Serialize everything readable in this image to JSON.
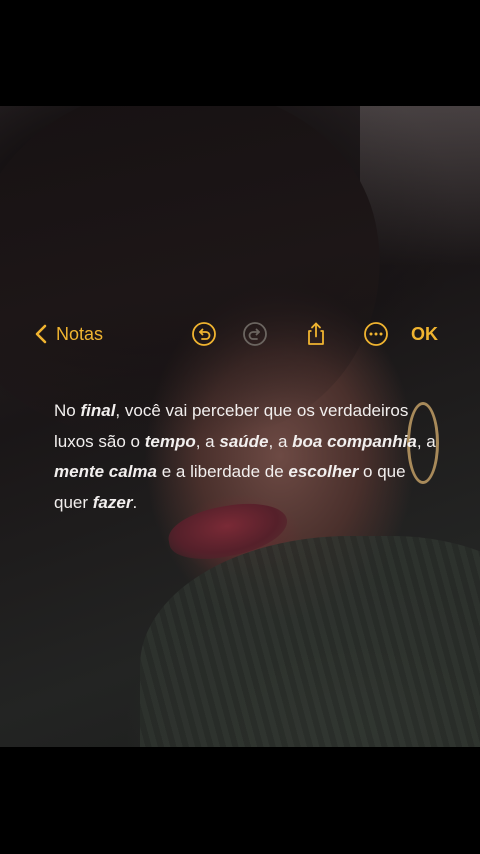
{
  "toolbar": {
    "back_label": "Notas",
    "ok_label": "OK",
    "icons": [
      "undo-icon",
      "redo-icon",
      "share-icon",
      "more-icon"
    ],
    "accent_color": "#f0b430"
  },
  "note": {
    "t1": "No ",
    "b1": "final",
    "t2": ", você vai perceber que os verdadeiros luxos são o ",
    "b2": "tempo",
    "t3": ", a ",
    "b3": "saúde",
    "t4": ", a ",
    "b4": "boa companhia",
    "t5": ", a ",
    "b5": "mente calma",
    "t6": " e a liberdade de ",
    "b6": "escolher",
    "t7": " o que quer ",
    "b7": "fazer",
    "t8": "."
  }
}
